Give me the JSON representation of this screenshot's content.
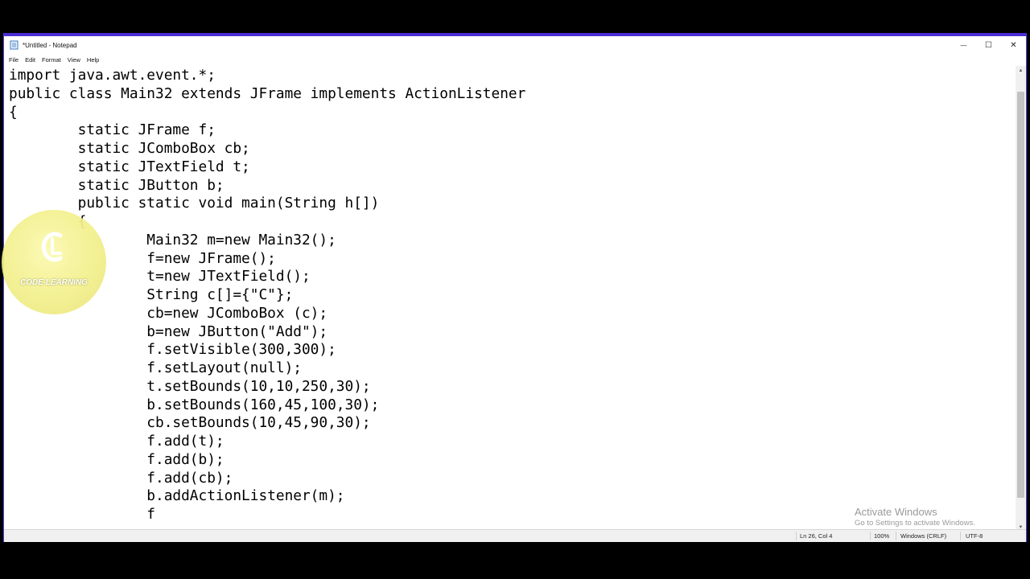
{
  "window": {
    "title": "*Untitled - Notepad",
    "controls": {
      "minimize": "—",
      "maximize": "☐",
      "close": "✕"
    }
  },
  "menu": [
    "File",
    "Edit",
    "Format",
    "View",
    "Help"
  ],
  "editor": {
    "lines": [
      "import java.awt.event.*;",
      "public class Main32 extends JFrame implements ActionListener",
      "{",
      "        static JFrame f;",
      "        static JComboBox cb;",
      "        static JTextField t;",
      "        static JButton b;",
      "        public static void main(String h[])",
      "        {",
      "                Main32 m=new Main32();",
      "                f=new JFrame();",
      "                t=new JTextField();",
      "                String c[]={\"C\"};",
      "                cb=new JComboBox (c);",
      "                b=new JButton(\"Add\");",
      "                f.setVisible(300,300);",
      "                f.setLayout(null);",
      "                t.setBounds(10,10,250,30);",
      "                b.setBounds(160,45,100,30);",
      "                cb.setBounds(10,45,90,30);",
      "                f.add(t);",
      "                f.add(b);",
      "                f.add(cb);",
      "                b.addActionListener(m);",
      "                f"
    ]
  },
  "status": {
    "position": "Ln 26, Col 4",
    "zoom": "100%",
    "line_ending": "Windows (CRLF)",
    "encoding": "UTF-8"
  },
  "watermark": {
    "title": "Activate Windows",
    "subtitle": "Go to Settings to activate Windows."
  },
  "logo": {
    "text": "CODE LEARNING",
    "mark": "CL"
  },
  "colors": {
    "window_border": "#4b2dd1",
    "logo_fill": "#f3f08c",
    "watermark": "#9a9a9a"
  }
}
